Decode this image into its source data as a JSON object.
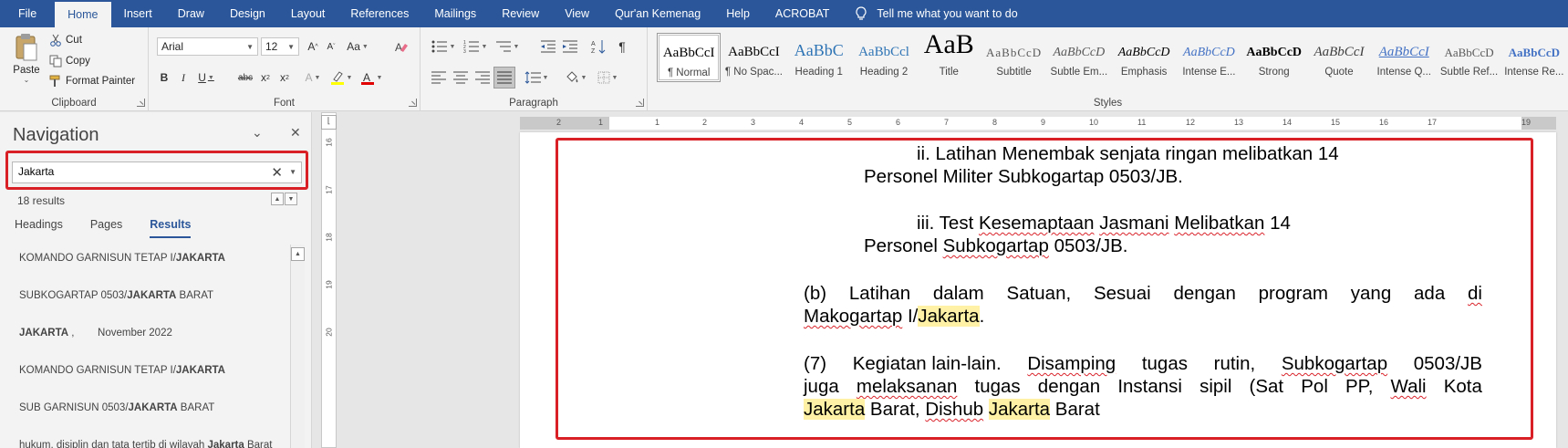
{
  "ribbon_tabs": [
    "File",
    "Home",
    "Insert",
    "Draw",
    "Design",
    "Layout",
    "References",
    "Mailings",
    "Review",
    "View",
    "Qur'an Kemenag",
    "Help",
    "ACROBAT"
  ],
  "active_tab": "Home",
  "tell_me": "Tell me what you want to do",
  "clipboard": {
    "paste": "Paste",
    "cut": "Cut",
    "copy": "Copy",
    "format_painter": "Format Painter",
    "label": "Clipboard"
  },
  "font": {
    "name": "Arial",
    "size": "12",
    "label": "Font"
  },
  "paragraph": {
    "label": "Paragraph"
  },
  "styles": {
    "label": "Styles",
    "items": [
      {
        "preview": "AaBbCcI",
        "name": "¶ Normal"
      },
      {
        "preview": "AaBbCcI",
        "name": "¶ No Spac..."
      },
      {
        "preview": "AaBbC",
        "name": "Heading 1"
      },
      {
        "preview": "AaBbCcl",
        "name": "Heading 2"
      },
      {
        "preview": "AaB",
        "name": "Title"
      },
      {
        "preview": "AaBbCcD",
        "name": "Subtitle"
      },
      {
        "preview": "AaBbCcD",
        "name": "Subtle Em..."
      },
      {
        "preview": "AaBbCcD",
        "name": "Emphasis"
      },
      {
        "preview": "AaBbCcD",
        "name": "Intense E..."
      },
      {
        "preview": "AaBbCcD",
        "name": "Strong"
      },
      {
        "preview": "AaBbCcI",
        "name": "Quote"
      },
      {
        "preview": "AaBbCcI",
        "name": "Intense Q..."
      },
      {
        "preview": "AaBbCcD",
        "name": "Subtle Ref..."
      },
      {
        "preview": "AaBbCcD",
        "name": "Intense Re..."
      }
    ]
  },
  "navigation": {
    "title": "Navigation",
    "search_value": "Jakarta",
    "results_count": "18 results",
    "tabs": [
      "Headings",
      "Pages",
      "Results"
    ],
    "active_tab": "Results",
    "results": [
      {
        "before": "KOMANDO GARNISUN TETAP I/",
        "match": "JAKARTA",
        "after": ""
      },
      {
        "before": "SUBKOGARTAP 0503/",
        "match": "JAKARTA",
        "after": " BARAT"
      },
      {
        "before": "",
        "match": "JAKARTA",
        "after": " ,        November 2022"
      },
      {
        "before": "KOMANDO GARNISUN TETAP I/",
        "match": "JAKARTA",
        "after": ""
      },
      {
        "before": "SUB GARNISUN 0503/",
        "match": "JAKARTA",
        "after": " BARAT"
      },
      {
        "before": "hukum, disiplin dan tata tertib di wilayah ",
        "match": "Jakarta",
        "after": " Barat"
      }
    ]
  },
  "vertical_ruler": [
    "16",
    "17",
    "18",
    "19",
    "20"
  ],
  "horizontal_ruler": [
    "2",
    "1",
    "1",
    "2",
    "3",
    "4",
    "5",
    "6",
    "7",
    "8",
    "9",
    "10",
    "11",
    "12",
    "13",
    "14",
    "15",
    "16",
    "17",
    "19"
  ],
  "document": {
    "l1": "ii. Latihan Menembak senjata ringan melibatkan 14",
    "l2": "Personel Militer Subkogartap 0503/JB.",
    "l3a": "iii. Test ",
    "l3b": "Kesemaptaan",
    "l3c": " ",
    "l3d": "Jasmani",
    "l3e": " ",
    "l3f": "Melibatkan",
    "l3g": " 14",
    "l4a": "Personel ",
    "l4b": "Subkogartap",
    "l4c": " 0503/JB.",
    "p1_words": [
      "(b)",
      "Latihan",
      "dalam",
      "Satuan,",
      "Sesuai",
      "dengan",
      "program",
      "yang",
      "ada",
      "di"
    ],
    "p1_l2a": "Makogartap",
    "p1_l2b": " I/",
    "p1_l2c": "Jakarta",
    "p1_l2d": ".",
    "p2_words": [
      "(7)",
      "Kegiatan lain-lain.",
      "Disamping",
      "tugas",
      "rutin,",
      "Subkogartap",
      "0503/JB"
    ],
    "p2_l2_words": [
      "juga",
      "melaksanan",
      "tugas",
      "dengan",
      "Instansi",
      "sipil",
      "(Sat",
      "Pol",
      "PP,",
      "Wali",
      "Kota"
    ],
    "p2_l3a": "Jakarta",
    "p2_l3b": " Barat, ",
    "p2_l3c": "Dishub",
    "p2_l3d": " ",
    "p2_l3e": "Jakarta",
    "p2_l3f": " Barat"
  },
  "colors": {
    "ribbon_tab_bar": "#2b579a",
    "highlight_frame": "#d92027",
    "search_hit": "#fff2a6"
  }
}
